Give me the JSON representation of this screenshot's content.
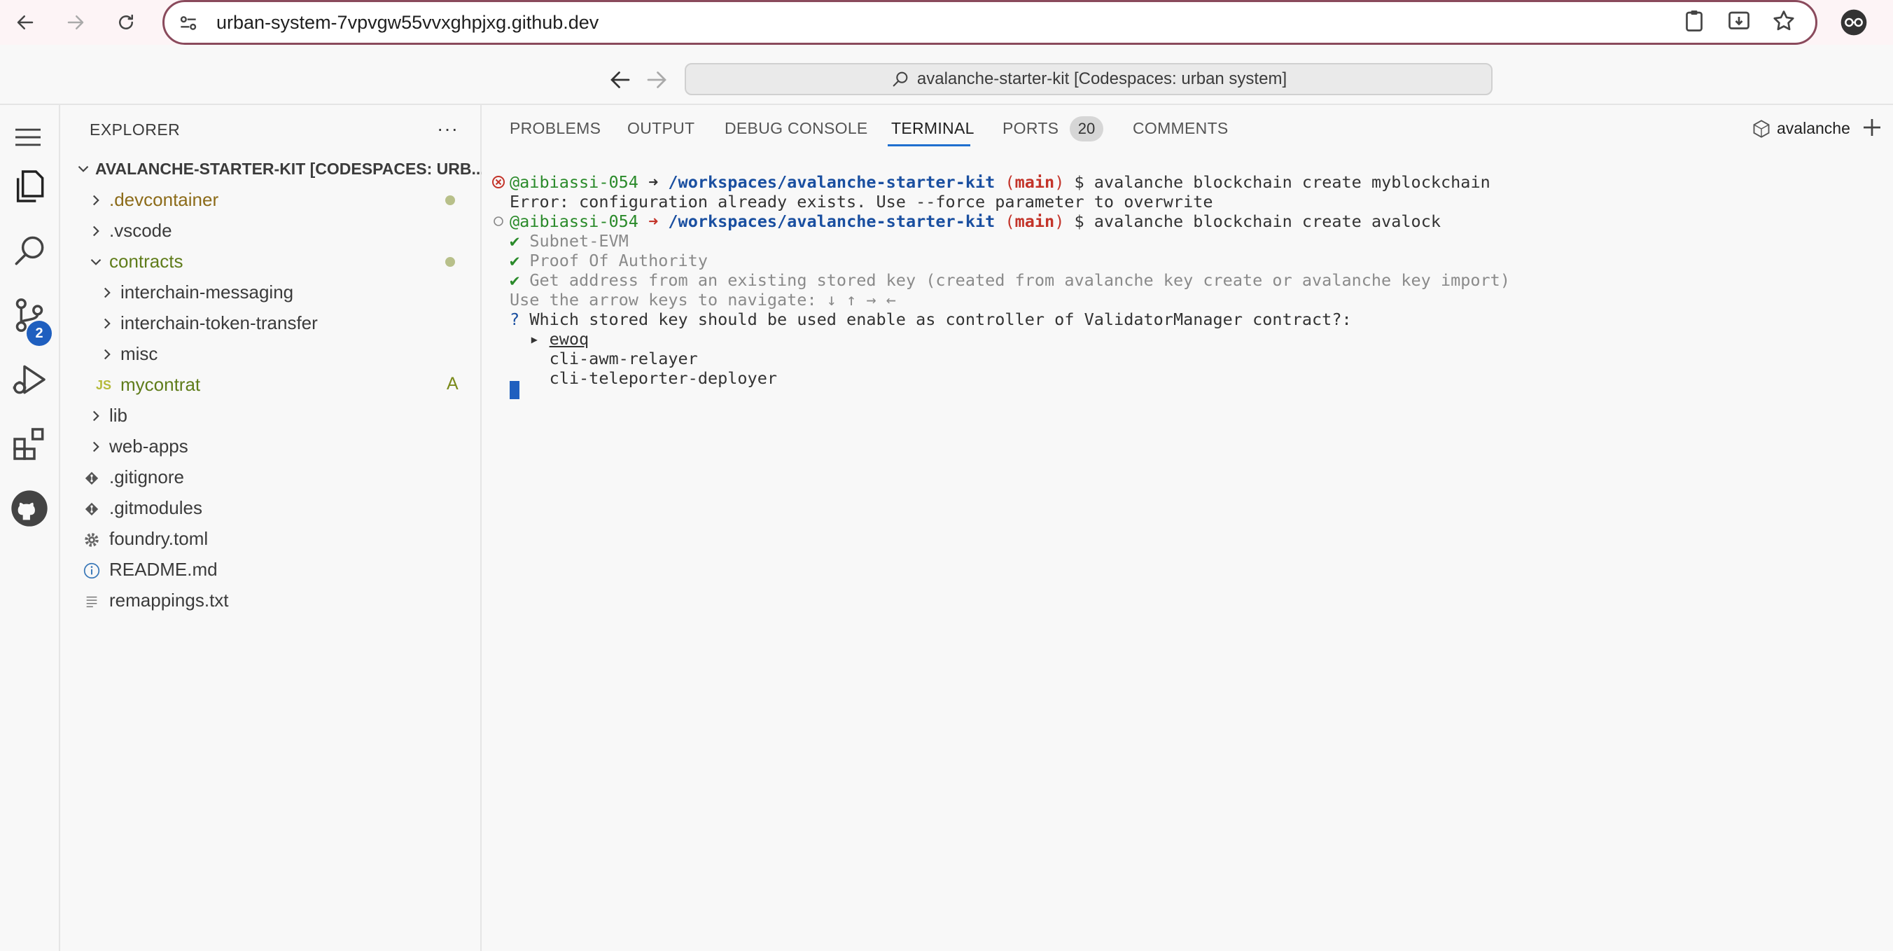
{
  "browser": {
    "url": "urban-system-7vpvgw55vvxghpjxg.github.dev"
  },
  "titlebar": {
    "command_center": "avalanche-starter-kit [Codespaces: urban system]"
  },
  "activity": {
    "scm_badge": "2"
  },
  "sidebar": {
    "title": "EXPLORER",
    "more": "···",
    "root_label": "AVALANCHE-STARTER-KIT [CODESPACES: URB...",
    "items": [
      {
        "label": ".devcontainer",
        "type": "folder",
        "status": "modified-dot"
      },
      {
        "label": ".vscode",
        "type": "folder",
        "status": ""
      },
      {
        "label": "contracts",
        "type": "folder-open",
        "status": "added-dot"
      },
      {
        "label": "interchain-messaging",
        "type": "folder",
        "status": ""
      },
      {
        "label": "interchain-token-transfer",
        "type": "folder",
        "status": ""
      },
      {
        "label": "misc",
        "type": "folder",
        "status": ""
      },
      {
        "label": "mycontrat",
        "type": "js-file",
        "status": "A"
      },
      {
        "label": "lib",
        "type": "folder",
        "status": ""
      },
      {
        "label": "web-apps",
        "type": "folder",
        "status": ""
      },
      {
        "label": ".gitignore",
        "type": "git-file",
        "status": ""
      },
      {
        "label": ".gitmodules",
        "type": "git-file",
        "status": ""
      },
      {
        "label": "foundry.toml",
        "type": "gear-file",
        "status": ""
      },
      {
        "label": "README.md",
        "type": "info-file",
        "status": ""
      },
      {
        "label": "remappings.txt",
        "type": "text-file",
        "status": ""
      }
    ],
    "js_icon_text": "JS"
  },
  "panel": {
    "tabs": [
      {
        "label": "PROBLEMS"
      },
      {
        "label": "OUTPUT"
      },
      {
        "label": "DEBUG CONSOLE"
      },
      {
        "label": "TERMINAL"
      },
      {
        "label": "PORTS"
      },
      {
        "label": "COMMENTS"
      }
    ],
    "ports_count": "20",
    "terminal_name": "avalanche"
  },
  "terminal": {
    "line1": {
      "user": "@aibiassi-054",
      "arrow": "➜",
      "path": "/workspaces/avalanche-starter-kit",
      "branch_open": "(",
      "branch": "main",
      "branch_close": ")",
      "cmd": "$ avalanche blockchain create myblockchain"
    },
    "line2": "Error: configuration already exists. Use --force parameter to overwrite",
    "line3": {
      "user": "@aibiassi-054",
      "arrow": "➜",
      "path": "/workspaces/avalanche-starter-kit",
      "branch_open": "(",
      "branch": "main",
      "branch_close": ")",
      "cmd": "$ avalanche blockchain create avalock"
    },
    "check_mark": "✔",
    "line4": "Subnet-EVM",
    "line5": "Proof Of Authority",
    "line6": "Get address from an existing stored key (created from avalanche key create or avalanche key import)",
    "line7": "Use the arrow keys to navigate: ↓ ↑ → ←",
    "q_mark": "?",
    "line8": "Which stored key should be used enable as controller of ValidatorManager contract?:",
    "pointer": "▸",
    "option1": "ewoq",
    "option2": "cli-awm-relayer",
    "option3": "cli-teleporter-deployer"
  },
  "colors": {
    "accent": "#1f6fcf",
    "badge": "#1f5fbf",
    "modified": "#8c6b19",
    "added": "#5f7c1a",
    "error": "#c3342a"
  }
}
